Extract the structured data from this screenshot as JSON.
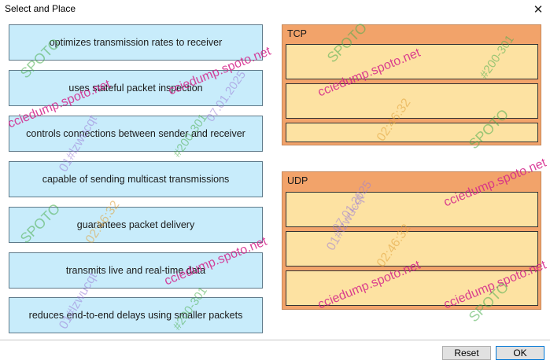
{
  "window": {
    "title": "Select and Place",
    "close_glyph": "✕",
    "close_icon": "close-icon"
  },
  "source_items": [
    {
      "label": "optimizes transmission rates to receiver"
    },
    {
      "label": "uses stateful packet inspection"
    },
    {
      "label": "controls connections between sender and receiver"
    },
    {
      "label": "capable of sending multicast transmissions"
    },
    {
      "label": "guarantees packet delivery"
    },
    {
      "label": "transmits live and real-time data"
    },
    {
      "label": "reduces end-to-end delays using smaller packets"
    }
  ],
  "targets": {
    "tcp": {
      "label": "TCP"
    },
    "udp": {
      "label": "UDP"
    }
  },
  "buttons": {
    "reset": "Reset",
    "ok": "OK"
  },
  "watermark": {
    "site": "cciedump.spoto.net",
    "brand": "SPOTO",
    "id": "#200-301",
    "user": "01#lzwucqt",
    "date": "07.01.2025",
    "time": "02:46:32",
    "site_color": "#d4238a",
    "brand_color": "#4caf50",
    "user_color": "#9b7fd8",
    "time_color": "#e0a23a"
  }
}
